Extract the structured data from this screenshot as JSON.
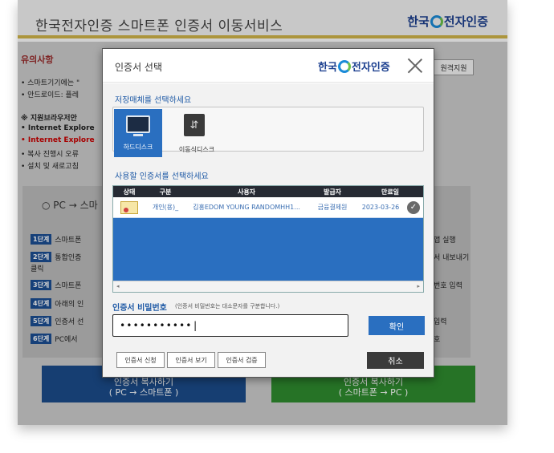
{
  "background": {
    "title": "한국전자인증 스마트폰 인증서 이동서비스",
    "brand": {
      "left": "한국",
      "right": "전자인증"
    },
    "notice_label": "유의사항",
    "remote_support": "원격지원",
    "notice_lines": [
      "• 스마트기기에는 \"",
      "• 안드로이드: 플레"
    ],
    "browser_lines": [
      {
        "text": "※ 지원브라우저안",
        "style": "bold"
      },
      {
        "text": "• Internet Explore",
        "style": "bold"
      },
      {
        "text": "• Internet Explore",
        "style": "red"
      },
      {
        "text": "• 복사 진행시 오류",
        "style": ""
      },
      {
        "text": "• 설치 및 새로고침",
        "style": ""
      }
    ],
    "pc_label": "○ PC → 스마",
    "steps": [
      {
        "badge": "1단계",
        "text": "스마트폰"
      },
      {
        "badge": "2단계",
        "text": "통합인증"
      },
      {
        "badge": "3단계",
        "text": "스마트폰"
      },
      {
        "badge": "4단계",
        "text": "아래의 인"
      },
      {
        "badge": "5단계",
        "text": "인증서 선"
      },
      {
        "badge": "6단계",
        "text": "PC에서"
      }
    ],
    "step2_cont": "클릭",
    "right_texts": [
      "앱 실행",
      "서 내보내기",
      "번호 입력",
      "입력",
      "호"
    ],
    "btn_pc_to_phone": {
      "title": "인증서 복사하기",
      "sub": "( PC → 스마트폰 )"
    },
    "btn_phone_to_pc": {
      "title": "인증서 복사하기",
      "sub": "( 스마트폰 → PC )"
    }
  },
  "modal": {
    "title": "인증서 선택",
    "brand": {
      "left": "한국",
      "right": "전자인증"
    },
    "storage_label": "저장매체를 선택하세요",
    "storage": {
      "hdd": "하드디스크",
      "usb": "이동식디스크"
    },
    "cert_label": "사용할 인증서를 선택하세요",
    "columns": [
      "상태",
      "구분",
      "사용자",
      "발급자",
      "만료일"
    ],
    "cert_row": {
      "type": "개인(용)_",
      "user": "김홍EDOM YOUNG RANDOMHH1...",
      "issuer": "금융결제원",
      "expiry": "2023-03-26"
    },
    "password_label": "인증서 비밀번호",
    "password_hint": "(인증서 비밀번호는 대소문자를 구분합니다.)",
    "password_value": "•••••••••••",
    "ok": "확인",
    "buttons": {
      "apply": "인증서 신청",
      "view": "인증서 보기",
      "verify": "인증서 검증"
    },
    "cancel": "취소"
  }
}
